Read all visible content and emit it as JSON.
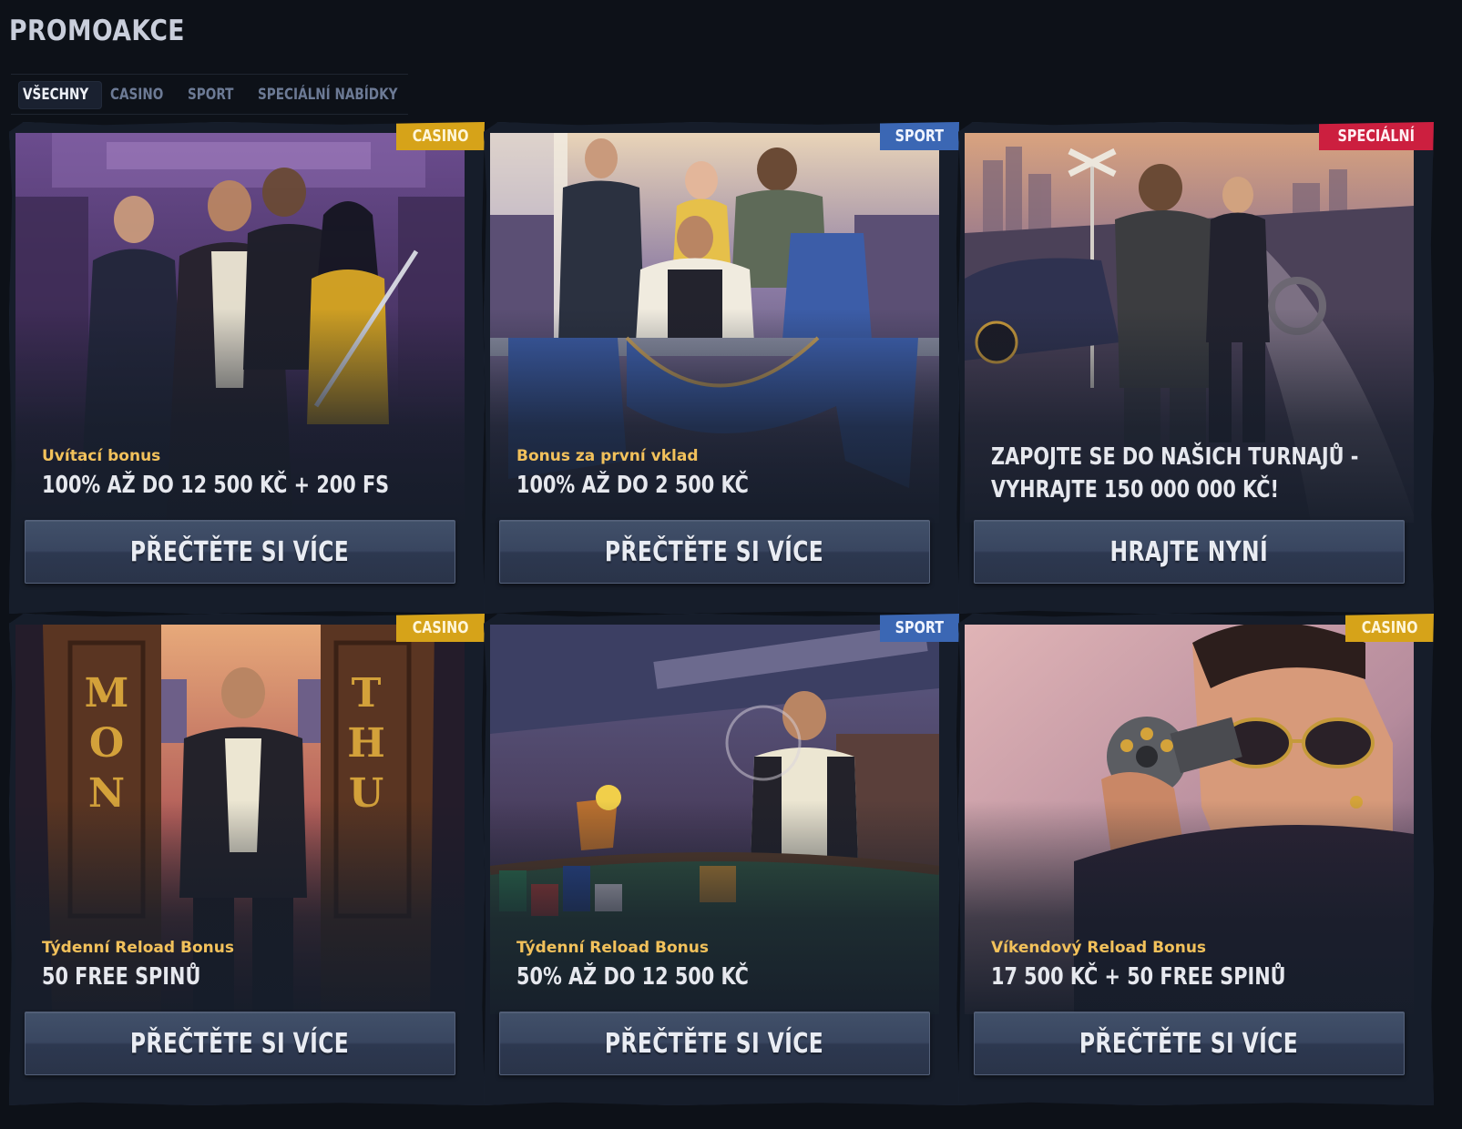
{
  "page": {
    "title": "PROMOAKCE"
  },
  "tabs": [
    {
      "label": "VŠECHNY",
      "active": true
    },
    {
      "label": "CASINO",
      "active": false
    },
    {
      "label": "SPORT",
      "active": false
    },
    {
      "label": "SPECIÁLNÍ NABÍDKY",
      "active": false
    }
  ],
  "cards": [
    {
      "badge": "CASINO",
      "badge_color": "#d6a319",
      "subtitle": "Uvítací bonus",
      "headline": "100% AŽ DO 12 500 KČ + 200 FS",
      "button": "PŘEČTĚTE SI VÍCE"
    },
    {
      "badge": "SPORT",
      "badge_color": "#3b67b4",
      "subtitle": "Bonus za první vklad",
      "headline": "100% AŽ DO 2 500 KČ",
      "button": "PŘEČTĚTE SI VÍCE"
    },
    {
      "badge": "SPECIÁLNÍ",
      "badge_color": "#cc1f3f",
      "subtitle": "",
      "headline_line1": "ZAPOJTE SE DO NAŠICH TURNAJŮ -",
      "headline_line2": "VYHRAJTE 150 000 000 KČ!",
      "button": "HRAJTE NYNÍ"
    },
    {
      "badge": "CASINO",
      "badge_color": "#d6a319",
      "subtitle": "Týdenní Reload Bonus",
      "headline": "50 FREE SPINŮ",
      "button": "PŘEČTĚTE SI VÍCE"
    },
    {
      "badge": "SPORT",
      "badge_color": "#3b67b4",
      "subtitle": "Týdenní Reload Bonus",
      "headline": "50% AŽ DO 12 500 KČ",
      "button": "PŘEČTĚTE SI VÍCE"
    },
    {
      "badge": "CASINO",
      "badge_color": "#d6a319",
      "subtitle": "Víkendový Reload Bonus",
      "headline": "17 500 KČ + 50 FREE SPINŮ",
      "button": "PŘEČTĚTE SI VÍCE"
    }
  ],
  "colors": {
    "background": "#0d1118",
    "subtitle_gold": "#f2c15b",
    "button_steel": "#3a4660"
  }
}
